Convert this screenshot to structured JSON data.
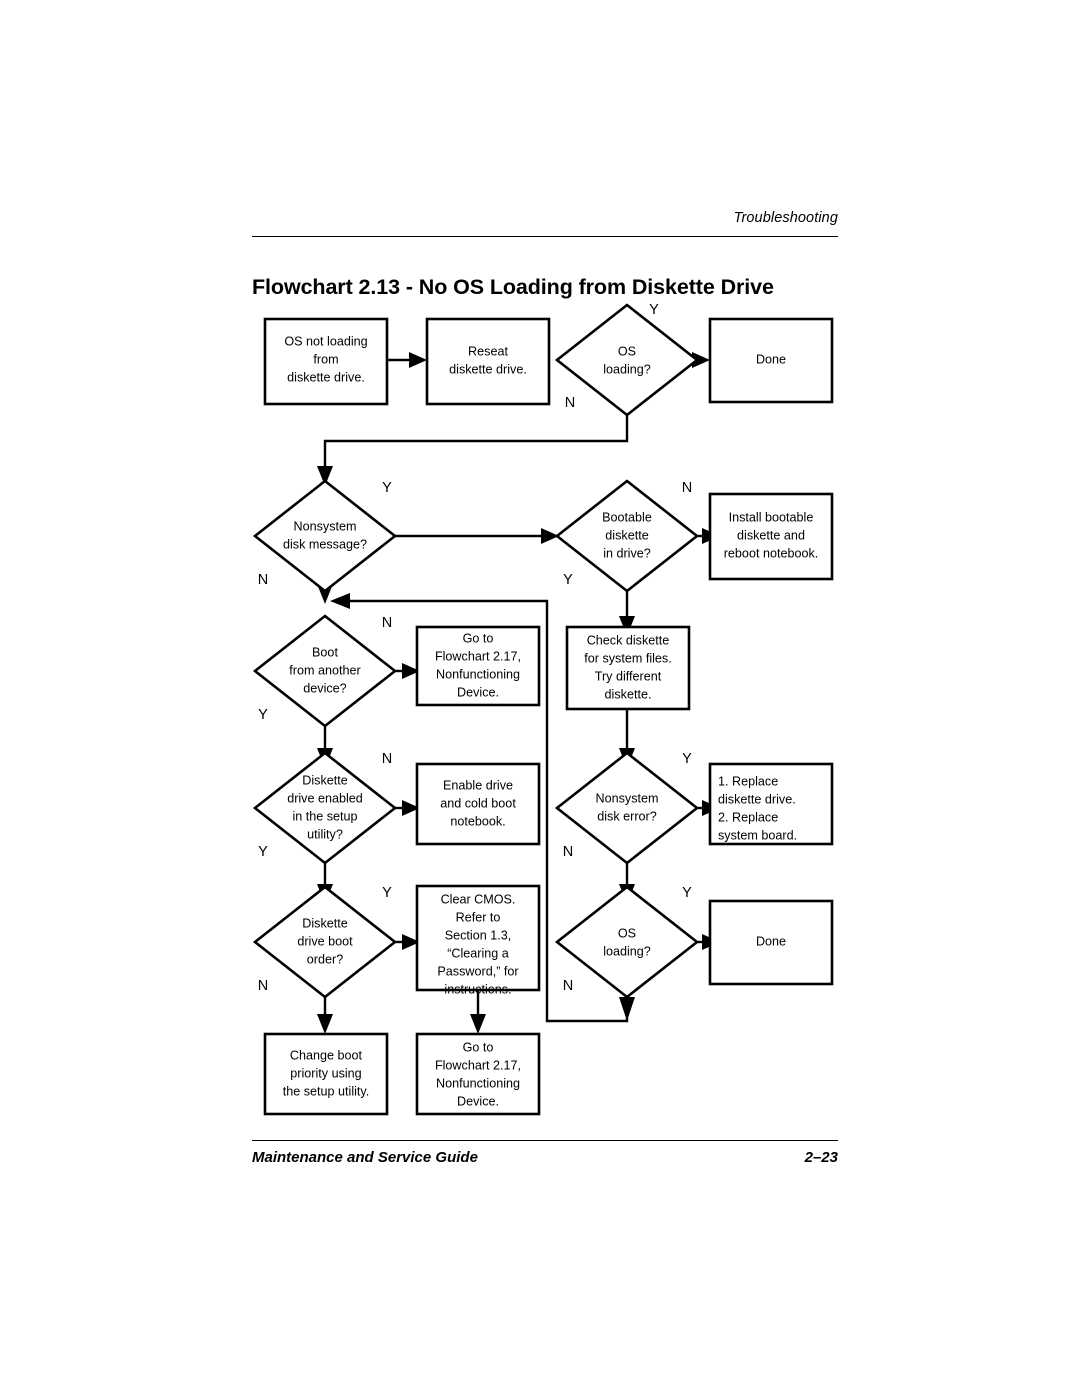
{
  "header": {
    "running_head": "Troubleshooting"
  },
  "title": "Flowchart 2.13 - No OS Loading from Diskette Drive",
  "footer": {
    "guide_name": "Maintenance and Service Guide",
    "page_number": "2–23"
  },
  "chart_data": {
    "type": "diagram",
    "title": "Flowchart 2.13 - No OS Loading from Diskette Drive",
    "nodes": [
      {
        "id": "start",
        "shape": "process",
        "lines": [
          "OS not loading",
          "from",
          "diskette drive."
        ]
      },
      {
        "id": "reseat",
        "shape": "process",
        "lines": [
          "Reseat",
          "diskette drive."
        ]
      },
      {
        "id": "os_loading_1",
        "shape": "decision",
        "lines": [
          "OS",
          "loading?"
        ]
      },
      {
        "id": "done_1",
        "shape": "process",
        "lines": [
          "Done"
        ]
      },
      {
        "id": "nonsystem_msg",
        "shape": "decision",
        "lines": [
          "Nonsystem",
          "disk message?"
        ]
      },
      {
        "id": "bootable_diskette",
        "shape": "decision",
        "lines": [
          "Bootable",
          "diskette",
          "in drive?"
        ]
      },
      {
        "id": "install_bootable",
        "shape": "process",
        "lines": [
          "Install bootable",
          "diskette and",
          "reboot notebook."
        ]
      },
      {
        "id": "boot_another",
        "shape": "decision",
        "lines": [
          "Boot",
          "from another",
          "device?"
        ]
      },
      {
        "id": "goto_217_a",
        "shape": "process",
        "lines": [
          "Go to",
          "Flowchart 2.17,",
          "Nonfunctioning",
          "Device."
        ]
      },
      {
        "id": "check_diskette",
        "shape": "process",
        "lines": [
          "Check diskette",
          "for system files.",
          "Try different",
          "diskette."
        ]
      },
      {
        "id": "drive_enabled",
        "shape": "decision",
        "lines": [
          "Diskette",
          "drive enabled",
          "in the setup",
          "utility?"
        ]
      },
      {
        "id": "enable_drive",
        "shape": "process",
        "lines": [
          "Enable drive",
          "and cold boot",
          "notebook."
        ]
      },
      {
        "id": "nonsystem_err",
        "shape": "decision",
        "lines": [
          "Nonsystem",
          "disk error?"
        ]
      },
      {
        "id": "replace_list",
        "shape": "process",
        "lines": [
          "1. Replace",
          "    diskette drive.",
          "2. Replace",
          "    system board."
        ]
      },
      {
        "id": "boot_order",
        "shape": "decision",
        "lines": [
          "Diskette",
          "drive boot",
          "order?"
        ]
      },
      {
        "id": "clear_cmos",
        "shape": "process",
        "lines": [
          "Clear CMOS.",
          "Refer to",
          "Section 1.3,",
          "“Clearing a",
          "Password,” for",
          "instructions."
        ]
      },
      {
        "id": "os_loading_2",
        "shape": "decision",
        "lines": [
          "OS",
          "loading?"
        ]
      },
      {
        "id": "done_2",
        "shape": "process",
        "lines": [
          "Done"
        ]
      },
      {
        "id": "change_priority",
        "shape": "process",
        "lines": [
          "Change boot",
          "priority using",
          "the setup utility."
        ]
      },
      {
        "id": "goto_217_b",
        "shape": "process",
        "lines": [
          "Go to",
          "Flowchart 2.17,",
          "Nonfunctioning",
          "Device."
        ]
      }
    ],
    "edges": [
      {
        "from": "start",
        "to": "reseat",
        "label": ""
      },
      {
        "from": "reseat",
        "to": "os_loading_1",
        "label": ""
      },
      {
        "from": "os_loading_1",
        "to": "done_1",
        "label": "Y"
      },
      {
        "from": "os_loading_1",
        "to": "nonsystem_msg",
        "label": "N"
      },
      {
        "from": "nonsystem_msg",
        "to": "bootable_diskette",
        "label": "Y"
      },
      {
        "from": "nonsystem_msg",
        "to": "boot_another",
        "label": "N"
      },
      {
        "from": "bootable_diskette",
        "to": "install_bootable",
        "label": "N"
      },
      {
        "from": "bootable_diskette",
        "to": "check_diskette",
        "label": "Y"
      },
      {
        "from": "boot_another",
        "to": "goto_217_a",
        "label": "N"
      },
      {
        "from": "boot_another",
        "to": "drive_enabled",
        "label": "Y"
      },
      {
        "from": "check_diskette",
        "to": "nonsystem_err",
        "label": ""
      },
      {
        "from": "drive_enabled",
        "to": "enable_drive",
        "label": "N"
      },
      {
        "from": "drive_enabled",
        "to": "boot_order",
        "label": "Y"
      },
      {
        "from": "nonsystem_err",
        "to": "replace_list",
        "label": "Y"
      },
      {
        "from": "nonsystem_err",
        "to": "os_loading_2",
        "label": "N"
      },
      {
        "from": "boot_order",
        "to": "clear_cmos",
        "label": "Y"
      },
      {
        "from": "boot_order",
        "to": "change_priority",
        "label": "N"
      },
      {
        "from": "clear_cmos",
        "to": "goto_217_b",
        "label": ""
      },
      {
        "from": "os_loading_2",
        "to": "done_2",
        "label": "Y"
      },
      {
        "from": "os_loading_2",
        "to": "boot_another",
        "label": "N"
      }
    ],
    "branch_labels": [
      "Y",
      "N"
    ]
  }
}
